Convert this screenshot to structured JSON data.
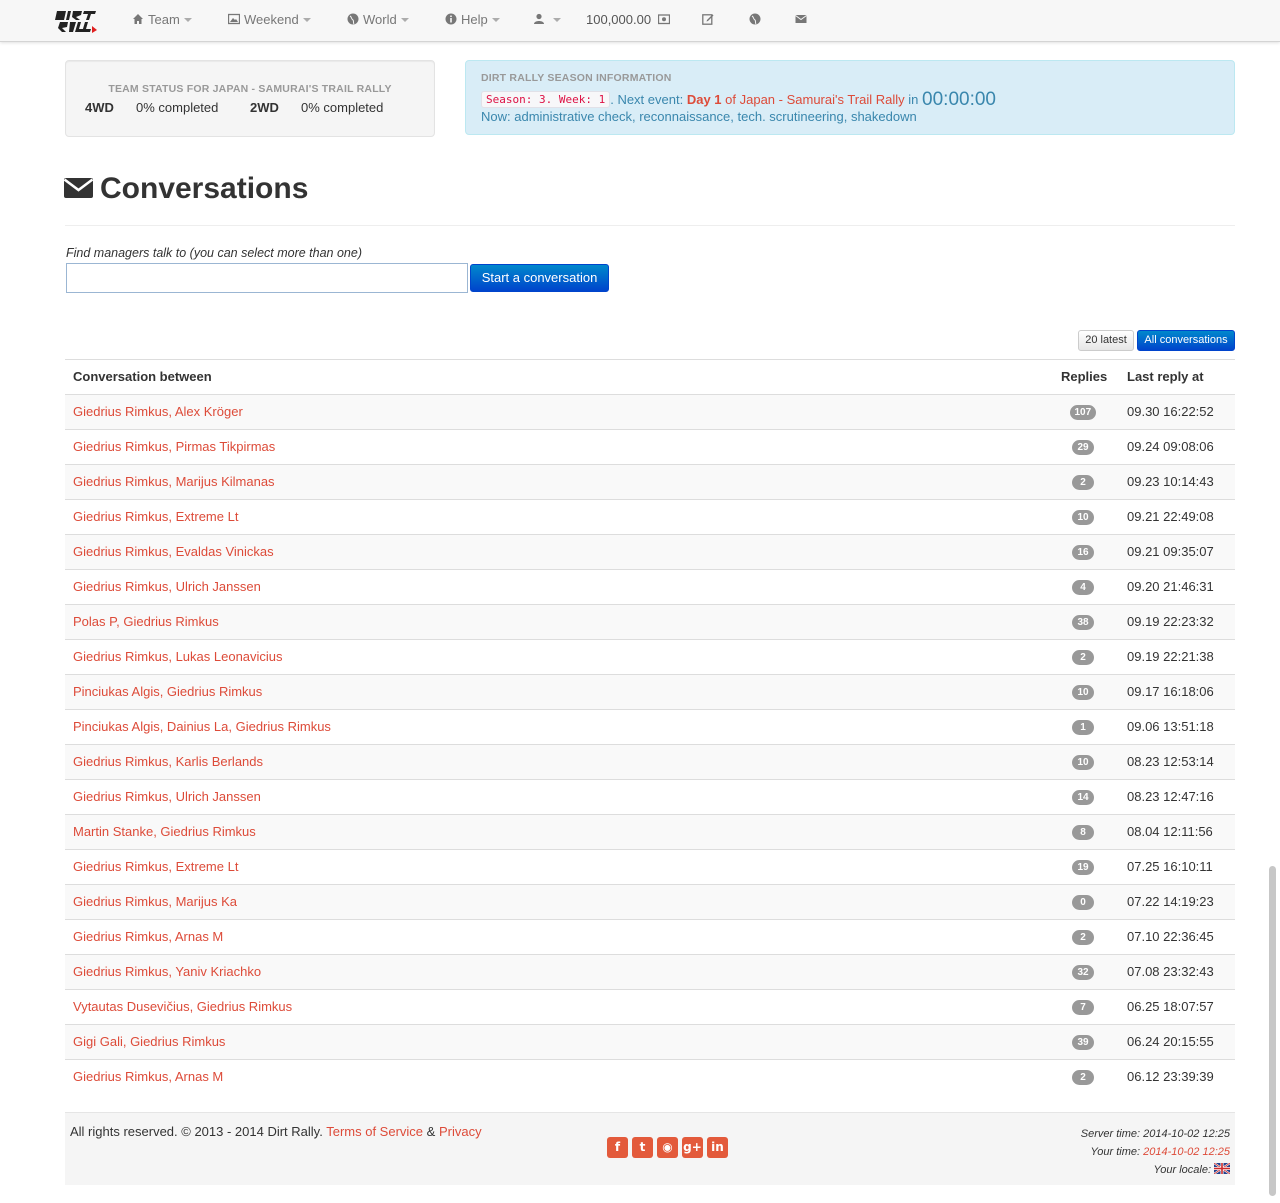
{
  "nav": {
    "items": [
      {
        "label": "Team",
        "icon": "home-icon"
      },
      {
        "label": "Weekend",
        "icon": "picture-icon"
      },
      {
        "label": "World",
        "icon": "globe-icon"
      },
      {
        "label": "Help",
        "icon": "info-icon"
      }
    ],
    "money": "100,000.00",
    "icons": [
      "user-icon",
      "camera-icon",
      "edit-icon",
      "globe-icon",
      "envelope-icon"
    ]
  },
  "team_status": {
    "title": "Team status for Japan - Samurai's Trail Rally",
    "drive1": "4WD",
    "drive1_value": "0% completed",
    "drive2": "2WD",
    "drive2_value": "0% completed"
  },
  "season": {
    "title": "Dirt Rally season information",
    "code": "Season: 3. Week: 1",
    "next_prefix": ". Next event:",
    "day": "Day 1",
    "of_text": "of Japan - Samurai's Trail Rally",
    "in_text": "in",
    "timer": "00:00:00",
    "now": "Now: administrative check, reconnaissance, tech. scrutineering, shakedown"
  },
  "page": {
    "title": "Conversations",
    "find_label": "Find managers talk to (you can select more than one)",
    "search_value": "",
    "start_button": "Start a conversation",
    "filter_latest": "20 latest",
    "filter_all": "All conversations"
  },
  "table": {
    "col_between": "Conversation between",
    "col_replies": "Replies",
    "col_last": "Last reply at",
    "rows": [
      {
        "between": "Giedrius Rimkus, Alex Kröger",
        "replies": "107",
        "last": "09.30 16:22:52"
      },
      {
        "between": "Giedrius Rimkus, Pirmas Tikpirmas",
        "replies": "29",
        "last": "09.24 09:08:06"
      },
      {
        "between": "Giedrius Rimkus, Marijus Kilmanas",
        "replies": "2",
        "last": "09.23 10:14:43"
      },
      {
        "between": "Giedrius Rimkus, Extreme Lt",
        "replies": "10",
        "last": "09.21 22:49:08"
      },
      {
        "between": "Giedrius Rimkus, Evaldas Vinickas",
        "replies": "16",
        "last": "09.21 09:35:07"
      },
      {
        "between": "Giedrius Rimkus, Ulrich Janssen",
        "replies": "4",
        "last": "09.20 21:46:31"
      },
      {
        "between": "Polas P, Giedrius Rimkus",
        "replies": "38",
        "last": "09.19 22:23:32"
      },
      {
        "between": "Giedrius Rimkus, Lukas Leonavicius",
        "replies": "2",
        "last": "09.19 22:21:38"
      },
      {
        "between": "Pinciukas Algis, Giedrius Rimkus",
        "replies": "10",
        "last": "09.17 16:18:06"
      },
      {
        "between": "Pinciukas Algis, Dainius La, Giedrius Rimkus",
        "replies": "1",
        "last": "09.06 13:51:18"
      },
      {
        "between": "Giedrius Rimkus, Karlis Berlands",
        "replies": "10",
        "last": "08.23 12:53:14"
      },
      {
        "between": "Giedrius Rimkus, Ulrich Janssen",
        "replies": "14",
        "last": "08.23 12:47:16"
      },
      {
        "between": "Martin Stanke, Giedrius Rimkus",
        "replies": "8",
        "last": "08.04 12:11:56"
      },
      {
        "between": "Giedrius Rimkus, Extreme Lt",
        "replies": "19",
        "last": "07.25 16:10:11"
      },
      {
        "between": "Giedrius Rimkus, Marijus Ka",
        "replies": "0",
        "last": "07.22 14:19:23"
      },
      {
        "between": "Giedrius Rimkus, Arnas M",
        "replies": "2",
        "last": "07.10 22:36:45"
      },
      {
        "between": "Giedrius Rimkus, Yaniv Kriachko",
        "replies": "32",
        "last": "07.08 23:32:43"
      },
      {
        "between": "Vytautas Dusevičius, Giedrius Rimkus",
        "replies": "7",
        "last": "06.25 18:07:57"
      },
      {
        "between": "Gigi Gali, Giedrius Rimkus",
        "replies": "39",
        "last": "06.24 20:15:55"
      },
      {
        "between": "Giedrius Rimkus, Arnas M",
        "replies": "2",
        "last": "06.12 23:39:39"
      }
    ]
  },
  "footer": {
    "copyright": "All rights reserved. © 2013 - 2014 Dirt Rally.",
    "terms": "Terms of Service",
    "amp": "&",
    "privacy": "Privacy",
    "server_label": "Server time:",
    "server_time": "2014-10-02 12:25",
    "your_label": "Your time:",
    "your_time": "2014-10-02 12:25",
    "locale_label": "Your locale:",
    "social": [
      "facebook-icon",
      "twitter-icon",
      "github-icon",
      "google-plus-icon",
      "linkedin-icon"
    ]
  },
  "colors": {
    "link": "#dd4b39",
    "primary": "#0055cc",
    "info_bg": "#d9edf7",
    "info_text": "#3a87ad",
    "badge": "#999999"
  }
}
